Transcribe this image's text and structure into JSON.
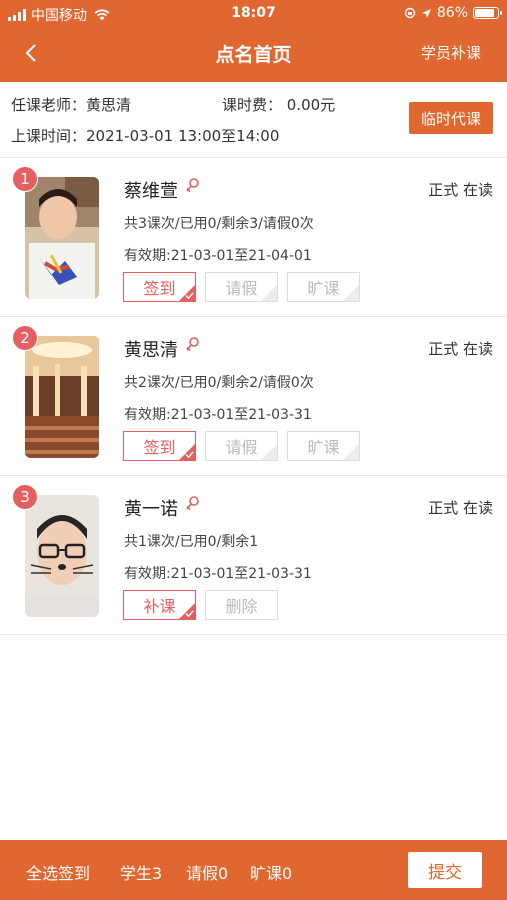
{
  "status_bar": {
    "carrier": "中国移动",
    "time": "18:07",
    "battery": "86%"
  },
  "nav": {
    "title": "点名首页",
    "right_label": "学员补课"
  },
  "info": {
    "teacher": "任课老师：黄思清",
    "fee": "课时费：  0.00元",
    "time": "上课时间：2021-03-01 13:00至14:00",
    "temp_button": "临时代课"
  },
  "students": [
    {
      "index": "1",
      "name": "蔡维萱",
      "status": "正式 在读",
      "counts": "共3课次/已用0/剩余3/请假0次",
      "valid": "有效期:21-03-01至21-04-01",
      "actions": [
        {
          "label": "签到",
          "active": true
        },
        {
          "label": "请假",
          "active": false
        },
        {
          "label": "旷课",
          "active": false
        }
      ]
    },
    {
      "index": "2",
      "name": "黄思清",
      "status": "正式 在读",
      "counts": "共2课次/已用0/剩余2/请假0次",
      "valid": "有效期:21-03-01至21-03-31",
      "actions": [
        {
          "label": "签到",
          "active": true
        },
        {
          "label": "请假",
          "active": false
        },
        {
          "label": "旷课",
          "active": false
        }
      ]
    },
    {
      "index": "3",
      "name": "黄一诺",
      "status": "正式 在读",
      "counts": "共1课次/已用0/剩余1",
      "valid": "有效期:21-03-01至21-03-31",
      "actions": [
        {
          "label": "补课",
          "active": true
        },
        {
          "label": "删除",
          "active": false
        }
      ]
    }
  ],
  "footer": {
    "select_all": "全选签到",
    "students": "学生3",
    "leave": "请假0",
    "absent": "旷课0",
    "submit": "提交"
  },
  "colors": {
    "accent": "#e0672f",
    "badge": "#e46060"
  }
}
